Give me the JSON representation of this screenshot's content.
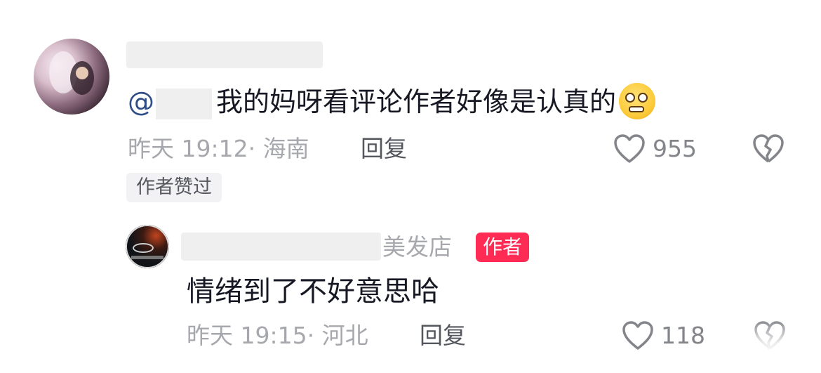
{
  "comment": {
    "mention_prefix": "@",
    "text": "我的妈呀看评论作者好像是认真的",
    "emoji": "pleading-face-emoji",
    "time": "昨天 19:12· 海南",
    "reply_label": "回复",
    "like_count": "955",
    "liked_tag": "作者赞过"
  },
  "reply": {
    "name_suffix": "美发店",
    "author_badge": "作者",
    "text": "情绪到了不好意思哈",
    "time": "昨天 19:15· 河北",
    "reply_label": "回复",
    "like_count": "118"
  },
  "colors": {
    "mention": "#2f4d87",
    "author_badge_bg": "#fe2c55",
    "meta_gray": "#a7a8ad"
  }
}
